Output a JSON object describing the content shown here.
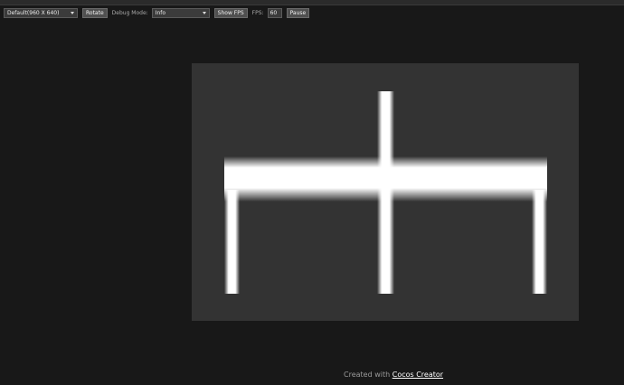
{
  "toolbar": {
    "device_select": {
      "value": "Default(960 X 640)"
    },
    "rotate_label": "Rotate",
    "debug_mode_label": "Debug Mode:",
    "debug_mode_select": {
      "value": "Info"
    },
    "show_fps_label": "Show FPS",
    "fps_label": "FPS:",
    "fps_value": "60",
    "pause_label": "Pause"
  },
  "footer": {
    "prefix": "Created with",
    "link_text": "Cocos Creator"
  },
  "colors": {
    "page_bg": "#181818",
    "canvas_bg": "#333333",
    "shape": "#ffffff"
  }
}
